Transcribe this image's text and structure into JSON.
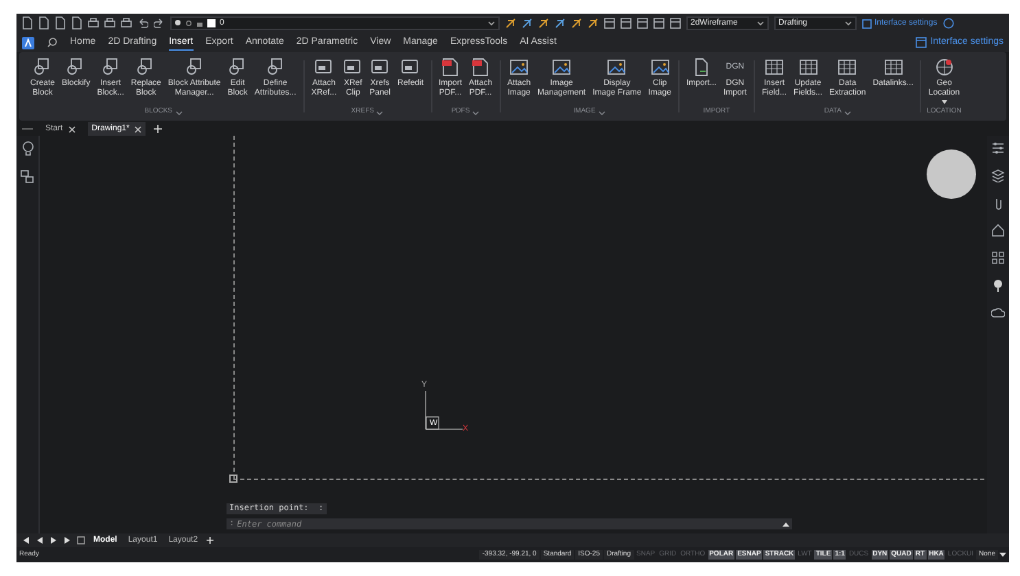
{
  "quick_access": {
    "layer": "0",
    "visual_style": "2dWireframe",
    "workspace": "Drafting",
    "settings_link": "Interface settings"
  },
  "ribbon_tabs": [
    {
      "label": "Home",
      "selected": false
    },
    {
      "label": "2D Drafting",
      "selected": false
    },
    {
      "label": "Insert",
      "selected": true
    },
    {
      "label": "Export",
      "selected": false
    },
    {
      "label": "Annotate",
      "selected": false
    },
    {
      "label": "2D Parametric",
      "selected": false
    },
    {
      "label": "View",
      "selected": false
    },
    {
      "label": "Manage",
      "selected": false
    },
    {
      "label": "ExpressTools",
      "selected": false
    },
    {
      "label": "AI Assist",
      "selected": false
    }
  ],
  "interface_settings": "Interface settings",
  "ribbon_groups": [
    {
      "kind": "blocks",
      "title": "BLOCKS",
      "expandable": true,
      "buttons": [
        {
          "label": "Create\nBlock"
        },
        {
          "label": "Blockify"
        },
        {
          "label": "Insert\nBlock..."
        },
        {
          "label": "Replace\nBlock"
        },
        {
          "label": "Block Attribute\nManager..."
        },
        {
          "label": "Edit\nBlock"
        },
        {
          "label": "Define\nAttributes..."
        }
      ]
    },
    {
      "kind": "xrefs",
      "title": "XREFS",
      "expandable": true,
      "buttons": [
        {
          "label": "Attach\nXRef..."
        },
        {
          "label": "XRef\nClip"
        },
        {
          "label": "Xrefs\nPanel"
        },
        {
          "label": "Refedit"
        }
      ]
    },
    {
      "kind": "pdfs",
      "title": "PDFS",
      "expandable": true,
      "buttons": [
        {
          "label": "Import\nPDF..."
        },
        {
          "label": "Attach\nPDF..."
        }
      ]
    },
    {
      "kind": "image",
      "title": "IMAGE",
      "expandable": true,
      "buttons": [
        {
          "label": "Attach\nImage"
        },
        {
          "label": "Image\nManagement"
        },
        {
          "label": "Display\nImage Frame"
        },
        {
          "label": "Clip\nImage"
        }
      ]
    },
    {
      "kind": "import",
      "title": "IMPORT",
      "expandable": false,
      "buttons": [
        {
          "label": "Import..."
        },
        {
          "label": "DGN\nImport",
          "icon_text": "DGN"
        }
      ]
    },
    {
      "kind": "data",
      "title": "DATA",
      "expandable": true,
      "buttons": [
        {
          "label": "Insert\nField..."
        },
        {
          "label": "Update\nFields..."
        },
        {
          "label": "Data\nExtraction"
        },
        {
          "label": "Datalinks..."
        }
      ]
    },
    {
      "kind": "location",
      "title": "LOCATION",
      "expandable": false,
      "buttons": [
        {
          "label": "Geo\nLocation",
          "dropdown": true
        }
      ]
    }
  ],
  "document_tabs": [
    {
      "label": "Start",
      "selected": false
    },
    {
      "label": "Drawing1*",
      "selected": true
    }
  ],
  "canvas": {
    "ucs": {
      "y": "Y",
      "w": "W",
      "x": "X"
    },
    "command_history": "Insertion point:  :",
    "command_prompt": ":",
    "command_placeholder": "Enter command"
  },
  "layout_tabs": [
    {
      "label": "Model",
      "selected": true
    },
    {
      "label": "Layout1",
      "selected": false
    },
    {
      "label": "Layout2",
      "selected": false
    }
  ],
  "status_bar": {
    "ready": "Ready",
    "coordinates": "-393.32, -99.21, 0",
    "info": [
      "Standard",
      "ISO-25",
      "Drafting"
    ],
    "toggles": [
      {
        "label": "SNAP",
        "on": false
      },
      {
        "label": "GRID",
        "on": false
      },
      {
        "label": "ORTHO",
        "on": false
      },
      {
        "label": "POLAR",
        "on": true
      },
      {
        "label": "ESNAP",
        "on": true
      },
      {
        "label": "STRACK",
        "on": true
      },
      {
        "label": "LWT",
        "on": false
      },
      {
        "label": "TILE",
        "on": true
      },
      {
        "label": "1:1",
        "on": true
      },
      {
        "label": "DUCS",
        "on": false
      },
      {
        "label": "DYN",
        "on": true
      },
      {
        "label": "QUAD",
        "on": true
      },
      {
        "label": "RT",
        "on": true
      },
      {
        "label": "HKA",
        "on": true
      },
      {
        "label": "LOCKUI",
        "on": false
      }
    ],
    "annotation_scale": "None"
  }
}
